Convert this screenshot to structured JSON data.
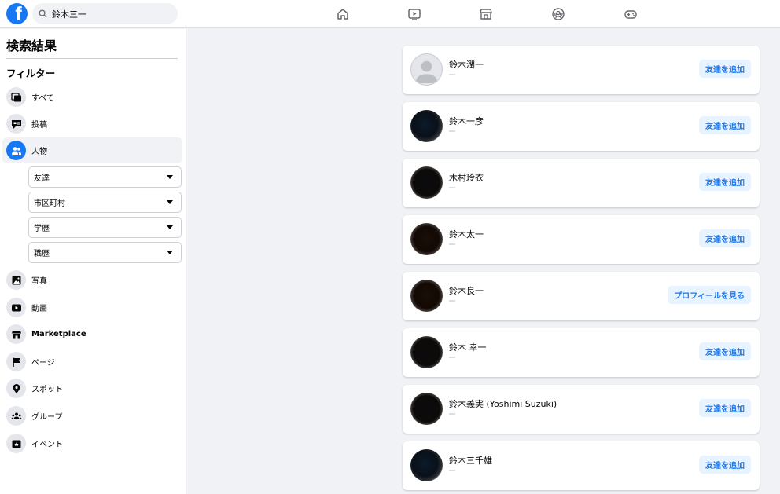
{
  "search": {
    "query": "鈴木三一"
  },
  "sidebar": {
    "title": "検索結果",
    "filter_heading": "フィルター",
    "items": [
      {
        "label": "すべて",
        "icon": "all-results-icon"
      },
      {
        "label": "投稿",
        "icon": "posts-icon"
      },
      {
        "label": "人物",
        "icon": "people-icon",
        "active": true
      },
      {
        "label": "写真",
        "icon": "photos-icon"
      },
      {
        "label": "動画",
        "icon": "videos-icon"
      },
      {
        "label": "Marketplace",
        "icon": "marketplace-icon"
      },
      {
        "label": "ページ",
        "icon": "pages-flag-icon"
      },
      {
        "label": "スポット",
        "icon": "places-pin-icon"
      },
      {
        "label": "グループ",
        "icon": "groups-icon"
      },
      {
        "label": "イベント",
        "icon": "events-icon"
      }
    ],
    "people_filters": [
      {
        "label": "友達"
      },
      {
        "label": "市区町村"
      },
      {
        "label": "学歴"
      },
      {
        "label": "職歴"
      }
    ]
  },
  "results": [
    {
      "name": "鈴木潤一",
      "button": "友達を追加"
    },
    {
      "name": "鈴木一彦",
      "button": "友達を追加"
    },
    {
      "name": "木村玲衣",
      "button": "友達を追加"
    },
    {
      "name": "鈴木太一",
      "button": "友達を追加"
    },
    {
      "name": "鈴木良一",
      "button": "プロフィールを見る"
    },
    {
      "name": "鈴木 幸一",
      "button": "友達を追加"
    },
    {
      "name": "鈴木義実 (Yoshimi Suzuki)",
      "button": "友達を追加"
    },
    {
      "name": "鈴木三千雄",
      "button": "友達を追加"
    }
  ],
  "colors": {
    "brand": "#1877f2",
    "background": "#f0f2f5",
    "button_bg": "#e7f3ff"
  }
}
